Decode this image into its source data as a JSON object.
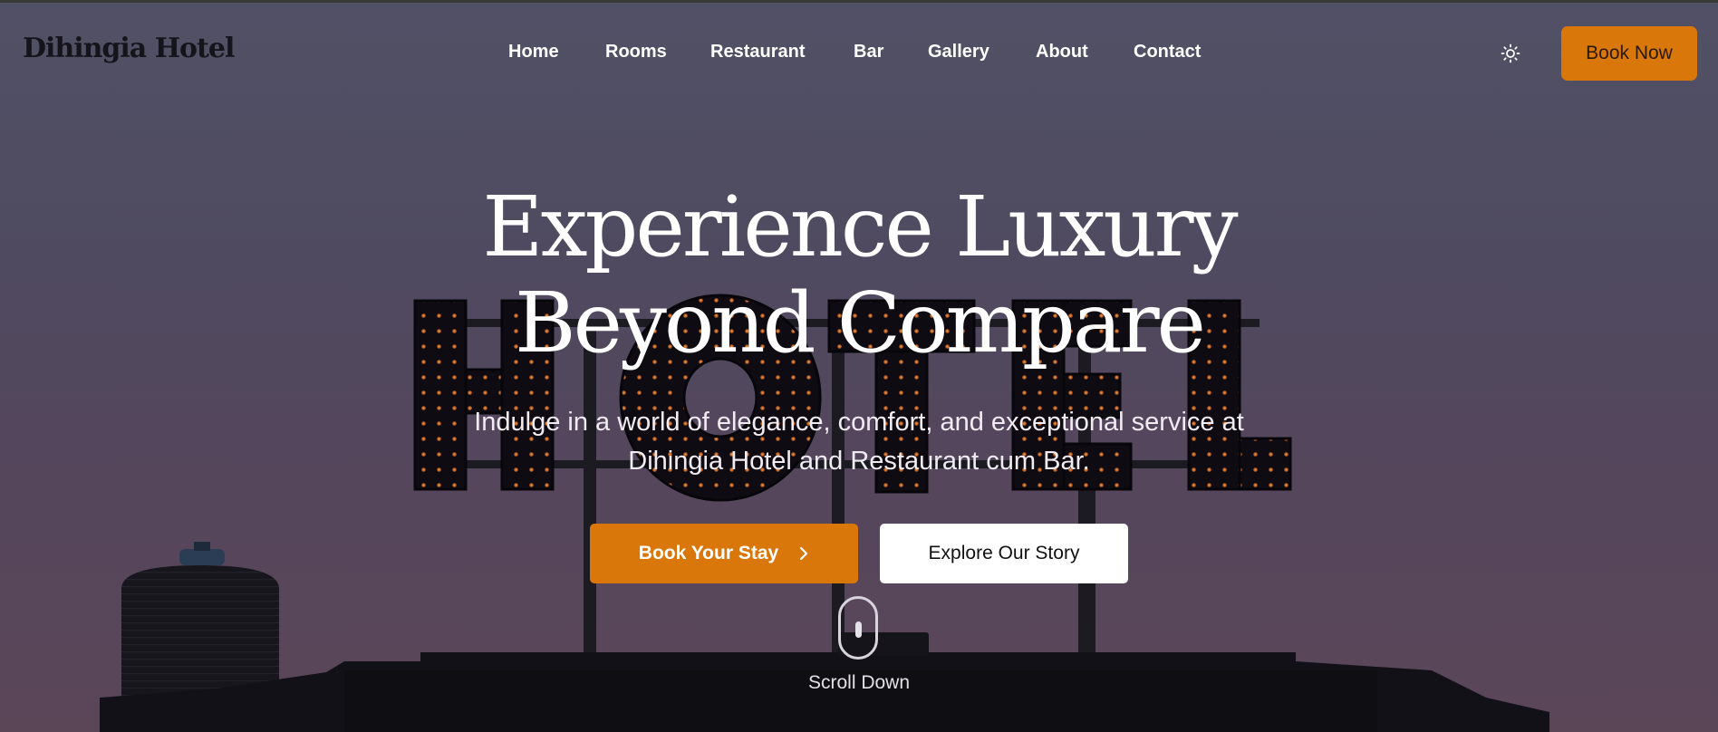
{
  "brand": {
    "name": "Dihingia Hotel"
  },
  "nav": {
    "items": [
      {
        "label": "Home"
      },
      {
        "label": "Rooms"
      },
      {
        "label": "Restaurant"
      },
      {
        "label": "Bar"
      },
      {
        "label": "Gallery"
      },
      {
        "label": "About"
      },
      {
        "label": "Contact"
      }
    ],
    "theme_toggle_icon": "sun-icon",
    "book_now_label": "Book Now"
  },
  "hero": {
    "background_sign_text": "HOTEL",
    "headline_line1": "Experience Luxury",
    "headline_line2": "Beyond Compare",
    "subtext_line1": "Indulge in a world of elegance, comfort, and exceptional service at",
    "subtext_line2": "Dihingia Hotel and Restaurant cum Bar.",
    "primary_cta_label": "Book Your Stay",
    "primary_cta_icon": "chevron-right-icon",
    "secondary_cta_label": "Explore Our Story",
    "scroll_icon": "mouse-scroll-icon",
    "scroll_label": "Scroll Down"
  },
  "colors": {
    "accent": "#d9770a",
    "overlay": "#4f4a60",
    "text_light": "#ffffff",
    "brand_text": "#15141a"
  }
}
